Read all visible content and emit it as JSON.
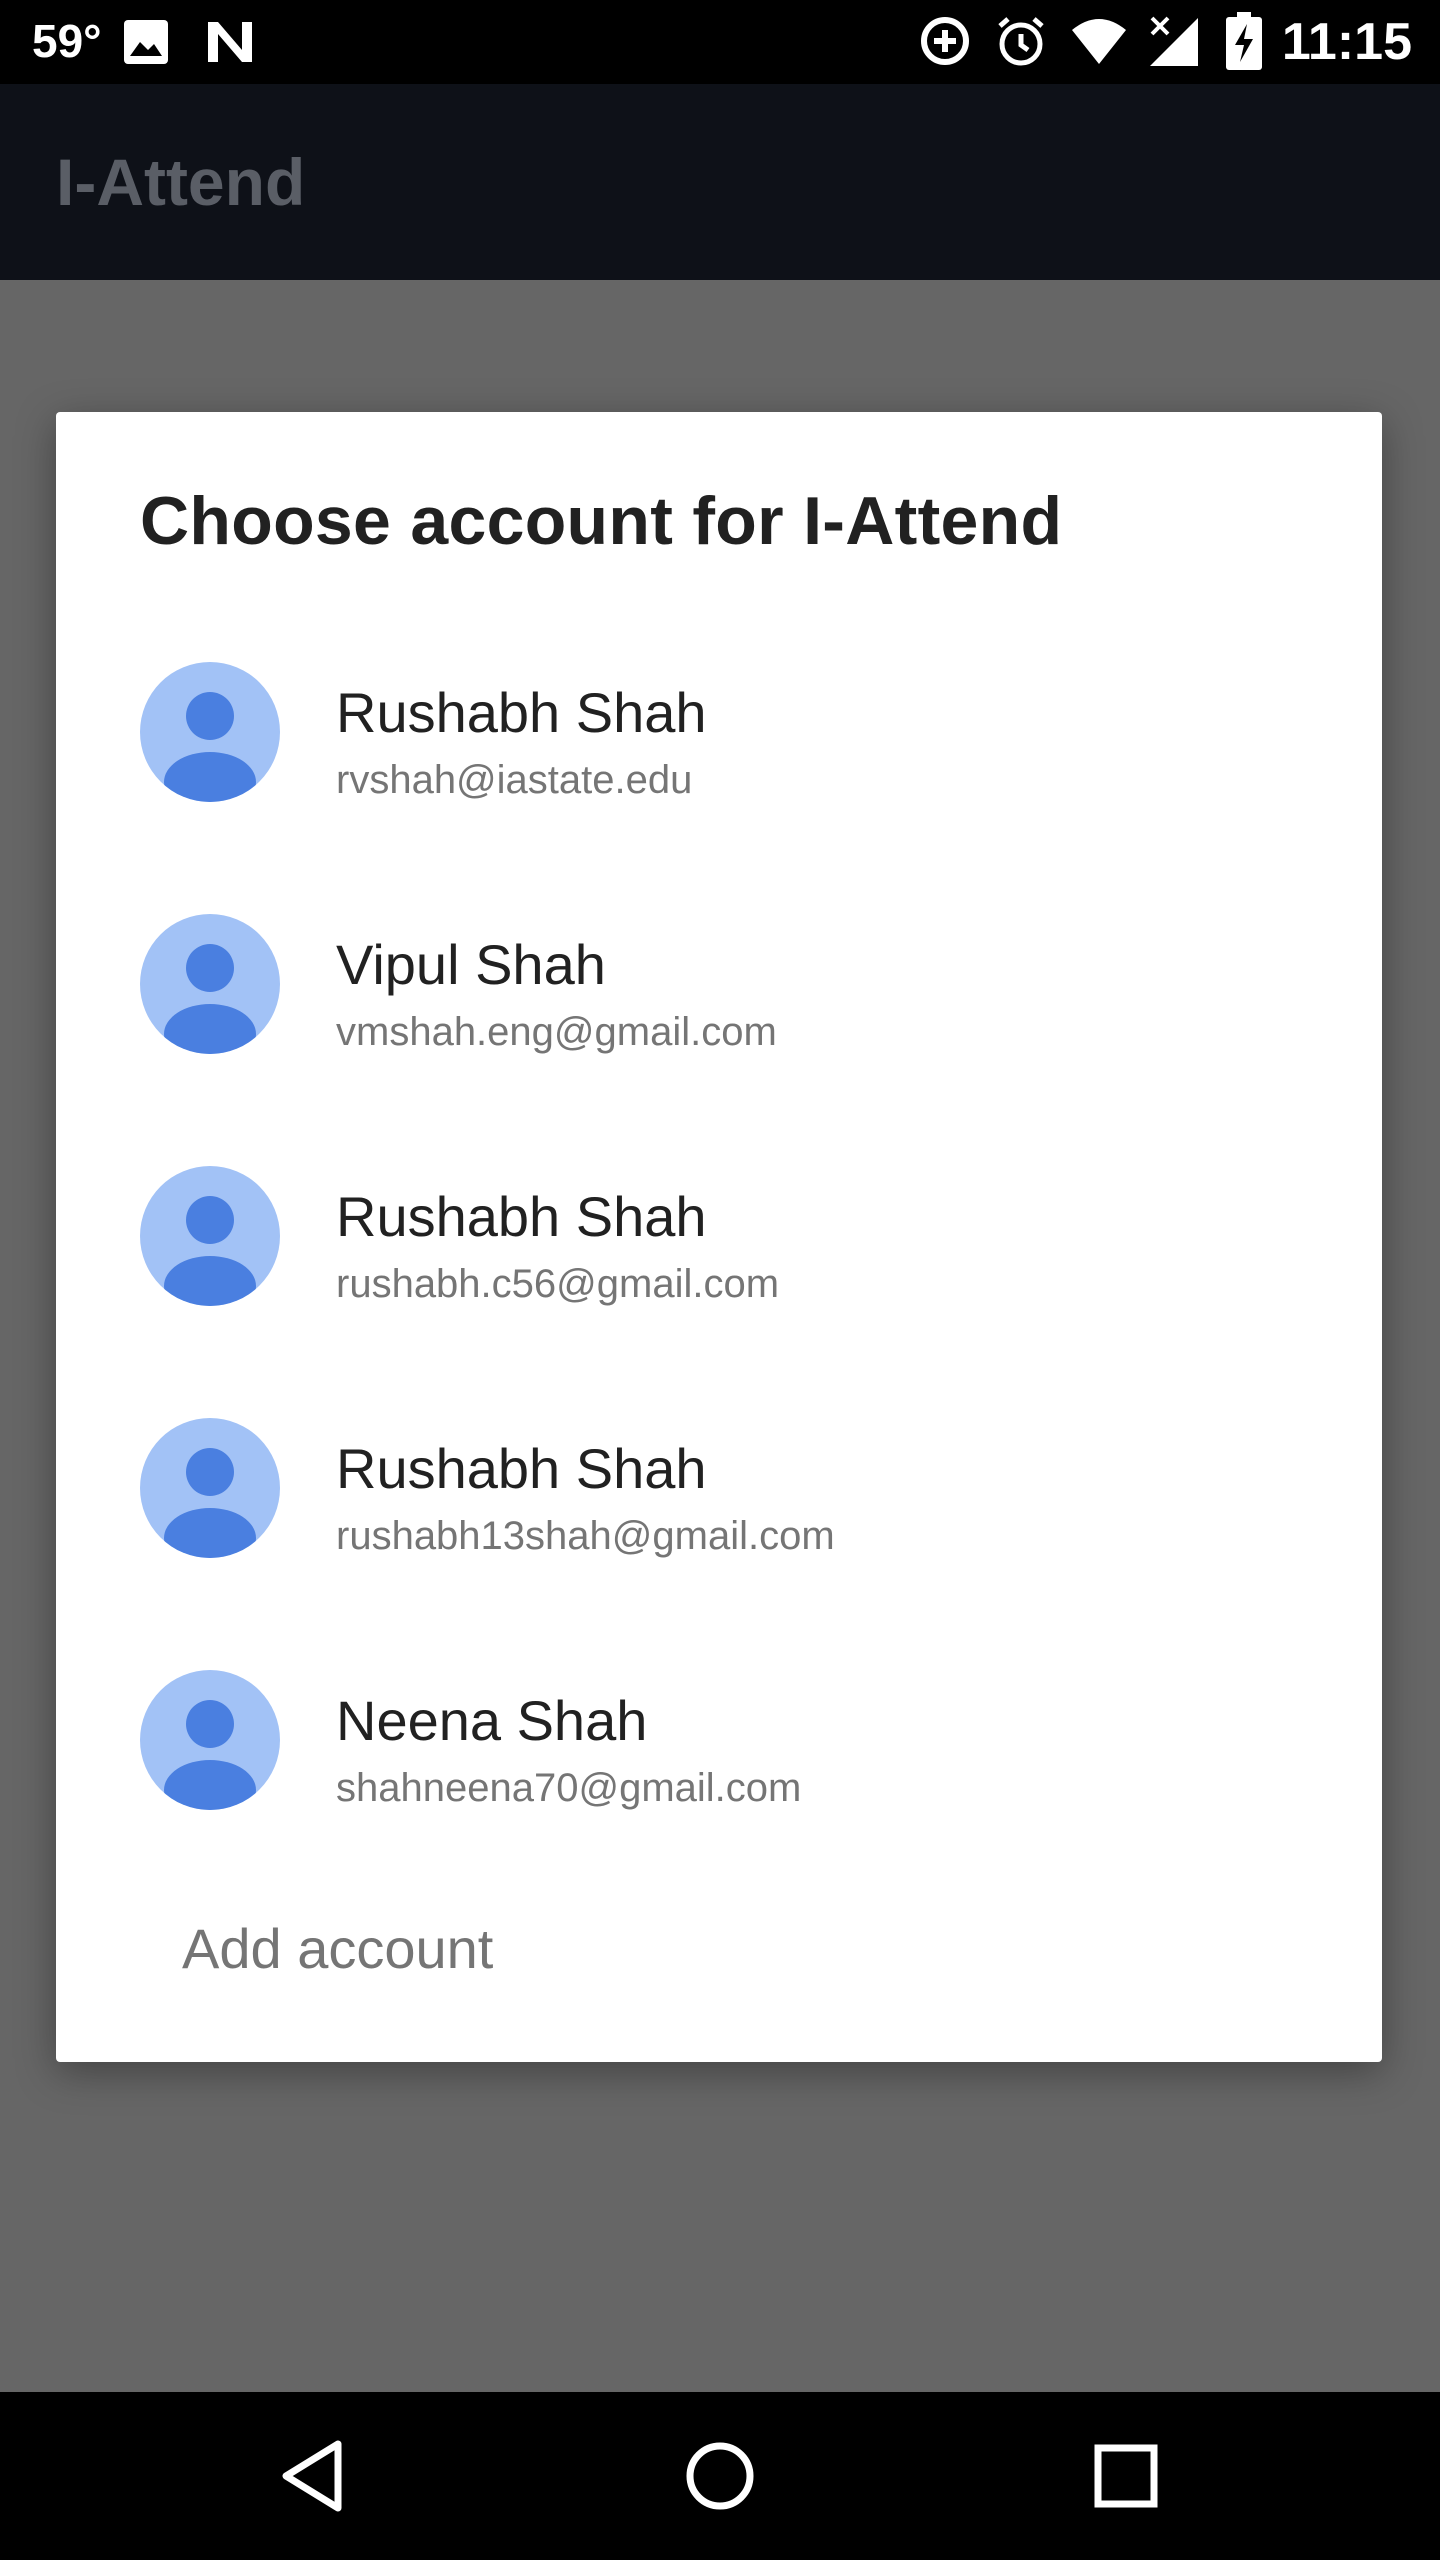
{
  "status_bar": {
    "temperature": "59°",
    "time": "11:15",
    "icons": [
      "image-icon",
      "n-logo-icon",
      "data-saver-icon",
      "alarm-icon",
      "wifi-icon",
      "signal-icon",
      "battery-charging-icon"
    ]
  },
  "app_bar": {
    "title": "I-Attend"
  },
  "dialog": {
    "title": "Choose account for I-Attend",
    "accounts": [
      {
        "name": "Rushabh Shah",
        "email": "rvshah@iastate.edu"
      },
      {
        "name": "Vipul Shah",
        "email": "vmshah.eng@gmail.com"
      },
      {
        "name": "Rushabh Shah",
        "email": "rushabh.c56@gmail.com"
      },
      {
        "name": "Rushabh Shah",
        "email": "rushabh13shah@gmail.com"
      },
      {
        "name": "Neena Shah",
        "email": "shahneena70@gmail.com"
      }
    ],
    "add_account_label": "Add account"
  },
  "nav_bar": {
    "icons": [
      "back-icon",
      "home-icon",
      "recents-icon"
    ]
  },
  "colors": {
    "avatar_bg": "#a2c2f6",
    "avatar_figure": "#4a7fe0",
    "scrim": "#666666",
    "dialog_bg": "#ffffff"
  }
}
